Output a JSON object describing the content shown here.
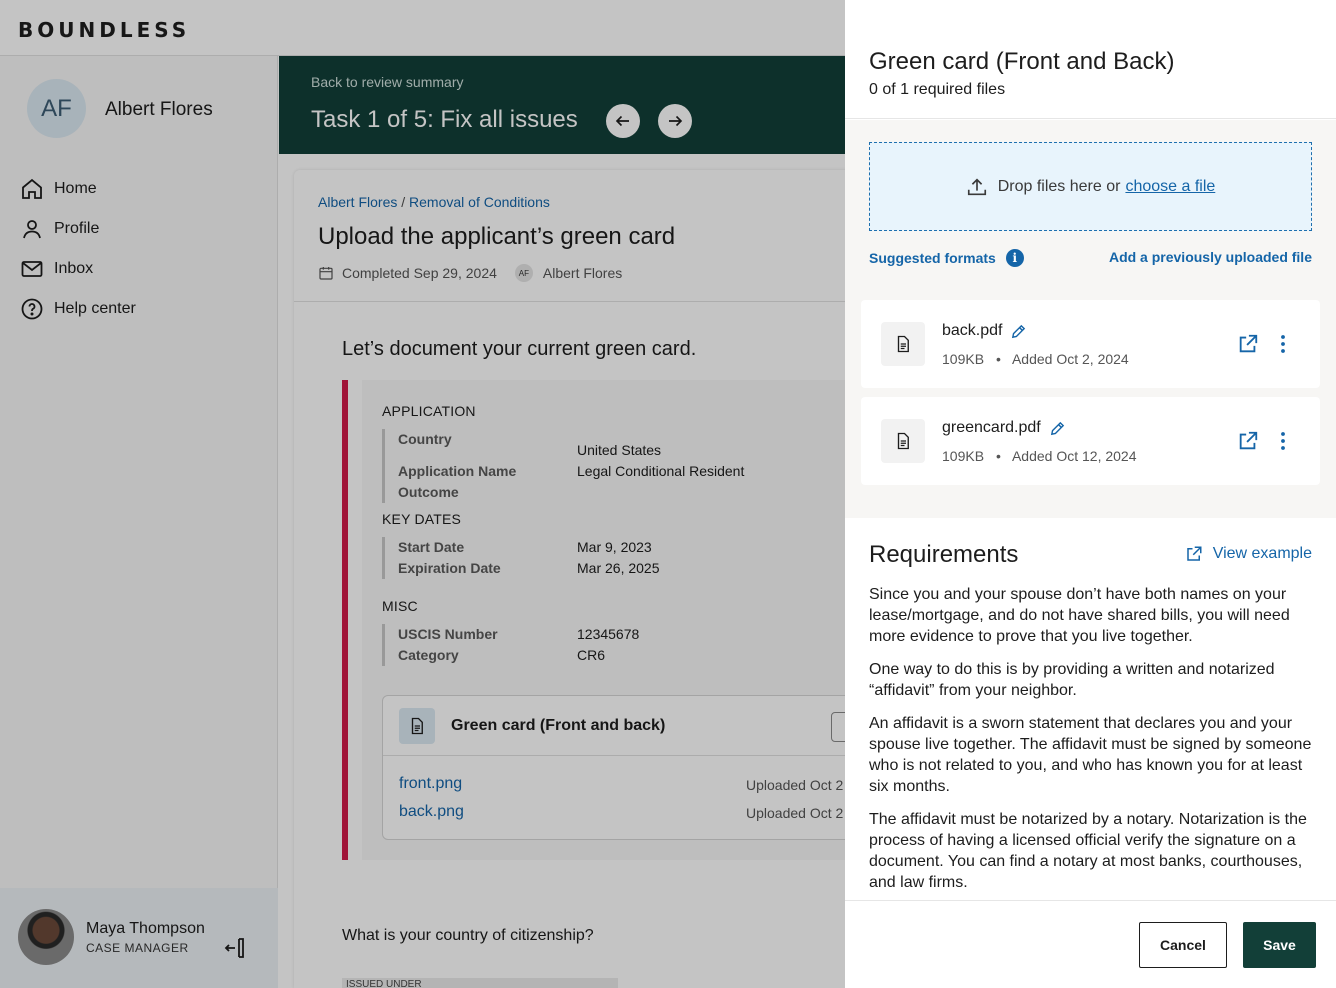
{
  "app": {
    "logo": "BOUNDLESS"
  },
  "sidebar": {
    "user_initials": "AF",
    "user_name": "Albert Flores",
    "items": [
      {
        "label": "Home",
        "icon": "home-icon"
      },
      {
        "label": "Profile",
        "icon": "user-icon"
      },
      {
        "label": "Inbox",
        "icon": "mail-icon"
      },
      {
        "label": "Help center",
        "icon": "help-icon"
      }
    ],
    "footer": {
      "name": "Maya Thompson",
      "role": "CASE MANAGER"
    }
  },
  "hero": {
    "back_link": "Back to review summary",
    "title": "Task 1 of 5: Fix all issues"
  },
  "card": {
    "crumb_client": "Albert Flores",
    "crumb_sep": "/",
    "crumb_case": "Removal of Conditions",
    "title": "Upload the applicant’s green card",
    "completed": "Completed Sep 29, 2024",
    "meta_initials": "AF",
    "meta_user": "Albert Flores",
    "section_lead": "Let’s document your current green card.",
    "groups": {
      "application": {
        "label": "APPLICATION",
        "rows": [
          {
            "k": "Country",
            "v": "United States"
          },
          {
            "k": "Application Name",
            "v": "Legal Conditional Resident"
          },
          {
            "k": "Outcome",
            "v": ""
          }
        ]
      },
      "key_dates": {
        "label": "KEY DATES",
        "rows": [
          {
            "k": "Start Date",
            "v": "Mar 9, 2023"
          },
          {
            "k": "Expiration Date",
            "v": "Mar 26, 2025"
          }
        ]
      },
      "misc": {
        "label": "MISC",
        "rows": [
          {
            "k": "USCIS Number",
            "v": "12345678"
          },
          {
            "k": "Category",
            "v": "CR6"
          }
        ]
      }
    },
    "doc_title": "Green card (Front and back)",
    "files": [
      {
        "name": "front.png",
        "uploaded": "Uploaded Oct 2"
      },
      {
        "name": "back.png",
        "uploaded": "Uploaded Oct 2"
      }
    ],
    "question": "What is your country of citizenship?",
    "issued_label": "ISSUED UNDER"
  },
  "drawer": {
    "title": "Green card (Front and Back)",
    "subtitle": "0 of 1 required files",
    "drop_text": "Drop files here or",
    "drop_link": "choose a file",
    "suggested_formats": "Suggested formats",
    "add_previous": "Add a previously uploaded file",
    "files": [
      {
        "name": "back.pdf",
        "size": "109KB",
        "sep": "•",
        "added": "Added Oct 2, 2024"
      },
      {
        "name": "greencard.pdf",
        "size": "109KB",
        "sep": "•",
        "added": "Added Oct 12, 2024"
      }
    ],
    "requirements_title": "Requirements",
    "view_example": "View example",
    "requirements_paragraphs": [
      "Since you and your spouse don’t have both names on your lease/mortgage, and do not have shared bills, you will need more evidence to prove that you live together.",
      "One way to do this is by providing a written and notarized “affidavit” from your neighbor.",
      "An affidavit is a sworn statement that declares you and your spouse live together. The affidavit must be signed by someone who is not related to you, and who has known you for at least six months.",
      "The affidavit must be notarized by a notary. Notarization is the process of having a licensed official verify the signature on a document. You can find a notary at most banks, courthouses, and law firms."
    ],
    "cancel_label": "Cancel",
    "save_label": "Save"
  },
  "colors": {
    "primary": "#123f38",
    "link": "#1565a8",
    "accent_error": "#d01b4a",
    "dropzone_bg": "#e8f4fc"
  }
}
